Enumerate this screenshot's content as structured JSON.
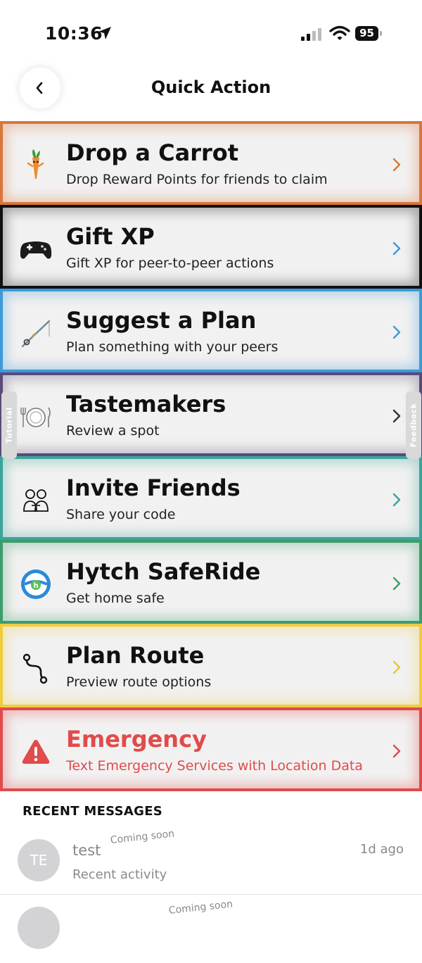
{
  "status": {
    "time": "10:36",
    "battery": "95",
    "icons": [
      "location-arrow-icon",
      "cellular-signal-icon",
      "wifi-icon",
      "battery-icon"
    ]
  },
  "nav": {
    "title": "Quick Action",
    "back_icon": "chevron-left-icon"
  },
  "actions": [
    {
      "title": "Drop a Carrot",
      "subtitle": "Drop Reward Points for friends to claim",
      "icon": "carrot-icon",
      "color": "#d9763a"
    },
    {
      "title": "Gift XP",
      "subtitle": "Gift XP for peer-to-peer actions",
      "icon": "gamepad-icon",
      "color": "#111111"
    },
    {
      "title": "Suggest a Plan",
      "subtitle": "Plan something with your peers",
      "icon": "fishing-rod-icon",
      "color": "#3c9ad8"
    },
    {
      "title": "Tastemakers",
      "subtitle": "Review a spot",
      "icon": "plate-cutlery-icon",
      "color": "#5a4a78"
    },
    {
      "title": "Invite Friends",
      "subtitle": "Share your code",
      "icon": "friends-icon",
      "color": "#3aa49a"
    },
    {
      "title": "Hytch SafeRide",
      "subtitle": "Get home safe",
      "icon": "steering-wheel-icon",
      "color": "#3e9c6c"
    },
    {
      "title": "Plan Route",
      "subtitle": "Preview route options",
      "icon": "route-icon",
      "color": "#f0cc3c"
    },
    {
      "title": "Emergency",
      "subtitle": "Text Emergency Services with Location Data",
      "icon": "warning-icon",
      "color": "#e04b4b"
    }
  ],
  "side_tabs": {
    "left": "Tutorial",
    "right": "Feedback"
  },
  "recent": {
    "heading": "RECENT MESSAGES",
    "messages": [
      {
        "avatar": "TE",
        "name": "test",
        "badge": "Coming soon",
        "subtitle": "Recent activity",
        "time": "1d ago"
      }
    ]
  }
}
